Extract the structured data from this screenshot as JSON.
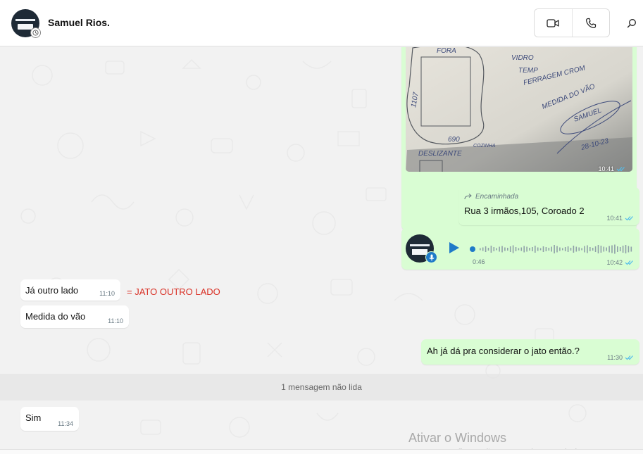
{
  "header": {
    "contact_name": "Samuel Rios.",
    "avatar_icon": "business-logo-avatar",
    "status_icon": "clock-icon",
    "video_call_icon": "video-camera-icon",
    "voice_call_icon": "phone-icon",
    "search_icon": "search-icon"
  },
  "messages": {
    "image": {
      "time": "10:41",
      "note_lines": [
        "VIDRO",
        "TEMP",
        "FERRAGEM CROM",
        "MEDIDA DO VÃO",
        "SAMUEL",
        "28-10-23"
      ],
      "sketch_labels": [
        "FORA",
        "DESLIZANTE",
        "690",
        "1107",
        "COZINHA"
      ]
    },
    "forwarded": {
      "label": "Encaminhada",
      "text": "Rua 3 irmãos,105, Coroado 2",
      "time": "10:41"
    },
    "voice": {
      "duration": "0:46",
      "time": "10:42"
    },
    "incoming_1": {
      "text": "Já outro lado",
      "time": "11:10"
    },
    "annotation": "= JATO OUTRO LADO",
    "incoming_2": {
      "text": "Medida do vão",
      "time": "11:10"
    },
    "outgoing_question": {
      "text": "Ah já dá pra considerar o jato então.?",
      "time": "11:30"
    },
    "unread_divider": "1 mensagem não lida",
    "incoming_3": {
      "text": "Sim",
      "time": "11:34"
    }
  },
  "watermark": {
    "title": "Ativar o Windows",
    "subtitle": "Acesse Configurações para ativar o Windows."
  },
  "colors": {
    "outgoing_bubble": "#d9fdd3",
    "incoming_bubble": "#ffffff",
    "read_ticks": "#53bdeb",
    "play_button": "#1f7ac8",
    "annotation_red": "#d93025"
  }
}
